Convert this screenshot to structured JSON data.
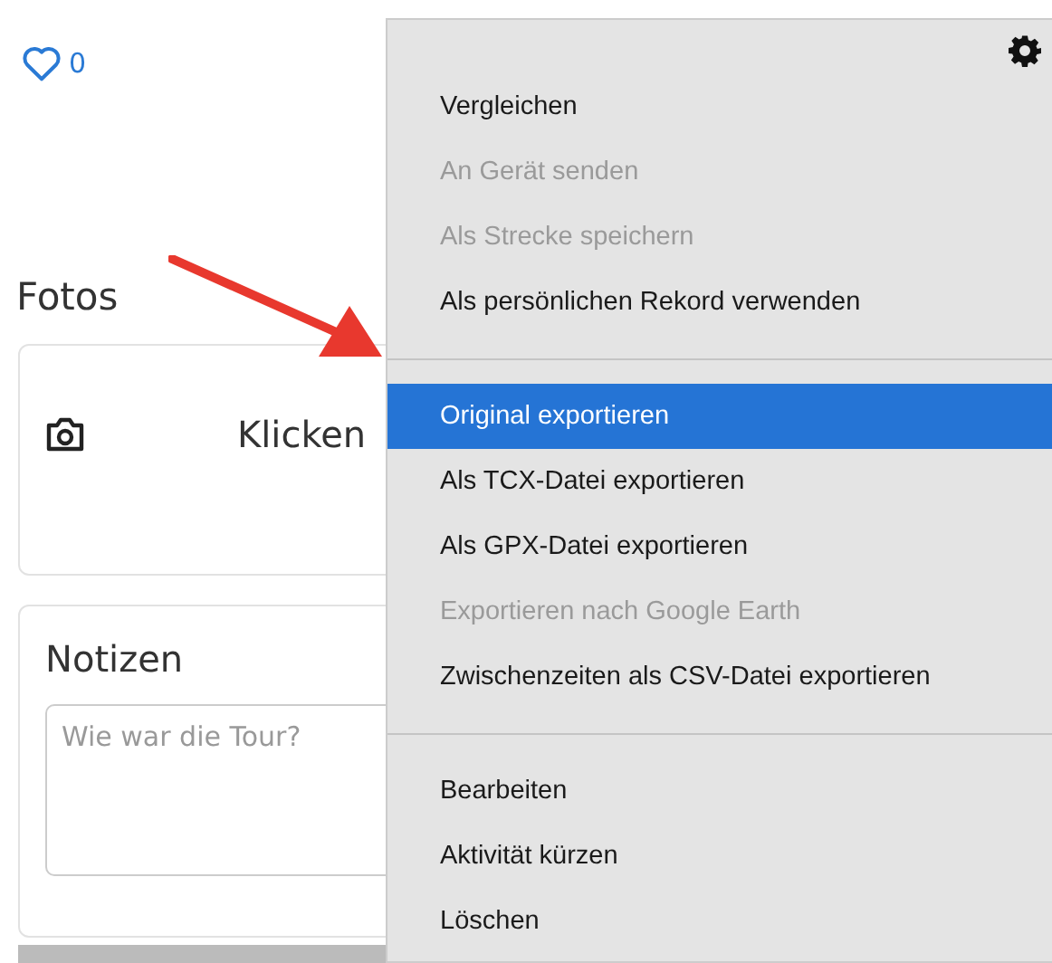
{
  "likes": {
    "count": "0"
  },
  "photos": {
    "title": "Fotos",
    "prompt": "Klicken"
  },
  "notes": {
    "title": "Notizen",
    "placeholder": "Wie war die Tour?"
  },
  "menu": {
    "groups": [
      {
        "items": [
          {
            "label": "Vergleichen",
            "disabled": false,
            "selected": false
          },
          {
            "label": "An Gerät senden",
            "disabled": true,
            "selected": false
          },
          {
            "label": "Als Strecke speichern",
            "disabled": true,
            "selected": false
          },
          {
            "label": "Als persönlichen Rekord verwenden",
            "disabled": false,
            "selected": false
          }
        ]
      },
      {
        "items": [
          {
            "label": "Original exportieren",
            "disabled": false,
            "selected": true
          },
          {
            "label": "Als TCX-Datei exportieren",
            "disabled": false,
            "selected": false
          },
          {
            "label": "Als GPX-Datei exportieren",
            "disabled": false,
            "selected": false
          },
          {
            "label": "Exportieren nach Google Earth",
            "disabled": true,
            "selected": false
          },
          {
            "label": "Zwischenzeiten als CSV-Datei exportieren",
            "disabled": false,
            "selected": false
          }
        ]
      },
      {
        "items": [
          {
            "label": "Bearbeiten",
            "disabled": false,
            "selected": false
          },
          {
            "label": "Aktivität kürzen",
            "disabled": false,
            "selected": false
          },
          {
            "label": "Löschen",
            "disabled": false,
            "selected": false
          }
        ]
      }
    ]
  }
}
